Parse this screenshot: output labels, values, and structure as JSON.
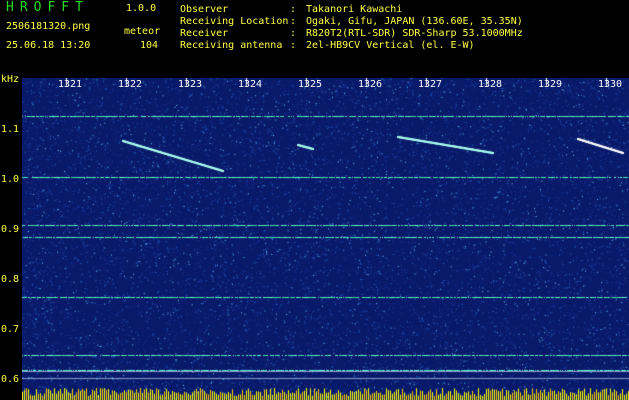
{
  "header": {
    "app_name": "HROFFT",
    "version": "1.0.0",
    "filename": "2506181320.png",
    "datetime": "25.06.18 13:20",
    "detection_type": "meteor",
    "detection_count": "104",
    "info": [
      {
        "label": "Observer",
        "value": "Takanori Kawachi"
      },
      {
        "label": "Receiving Location",
        "value": "Ogaki, Gifu, JAPAN (136.60E, 35.35N)"
      },
      {
        "label": "Receiver",
        "value": "R820T2(RTL-SDR) SDR-Sharp 53.1000MHz"
      },
      {
        "label": "Receiving antenna",
        "value": "2el-HB9CV Vertical (el. E-W)"
      }
    ]
  },
  "spectrogram": {
    "freq_unit": "kHz",
    "time_labels": [
      "1321",
      "1322",
      "1323",
      "1324",
      "1325",
      "1326",
      "1327",
      "1328",
      "1329",
      "1330"
    ],
    "freq_labels": [
      "1.1",
      "1.0",
      "0.9",
      "0.8",
      "0.7",
      "0.6"
    ],
    "colors": {
      "background": "#0a1a6a",
      "carrier": "#66ffcc",
      "noise_hi": "#33aaff",
      "meteor": "#ffffff",
      "bars": "#ffff00",
      "tick": "#ffffff"
    }
  }
}
